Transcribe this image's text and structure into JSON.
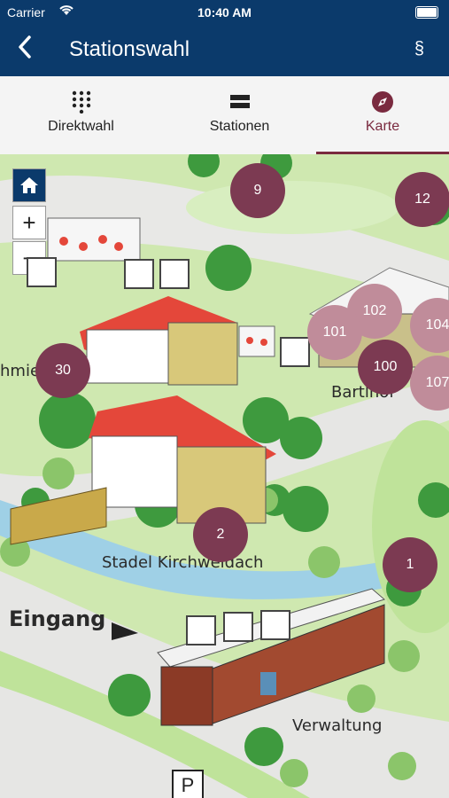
{
  "status": {
    "carrier": "Carrier",
    "time": "10:40 AM"
  },
  "nav": {
    "back_icon": "chevron-left-icon",
    "title": "Stationswahl",
    "right": "§"
  },
  "tabs": [
    {
      "label": "Direktwahl",
      "icon": "dialpad-icon"
    },
    {
      "label": "Stationen",
      "icon": "list-icon"
    },
    {
      "label": "Karte",
      "icon": "compass-icon"
    }
  ],
  "map": {
    "controls": {
      "home": "home-icon",
      "zoom_in": "+",
      "zoom_out": "−"
    },
    "markers": [
      "9",
      "12",
      "102",
      "101",
      "104",
      "100",
      "107",
      "30",
      "2",
      "1"
    ],
    "labels": {
      "bartlhof": "Bartlhof",
      "stadel": "Stadel Kirchweidach",
      "eingang": "Eingang",
      "verwaltung": "Verwaltung",
      "schmiede": "hmiede",
      "parking": "P"
    }
  },
  "colors": {
    "navy": "#0b3a6b",
    "marker_dark": "#7c3a52",
    "marker_light": "#c08c9a",
    "active_tab": "#7a2a3f"
  }
}
